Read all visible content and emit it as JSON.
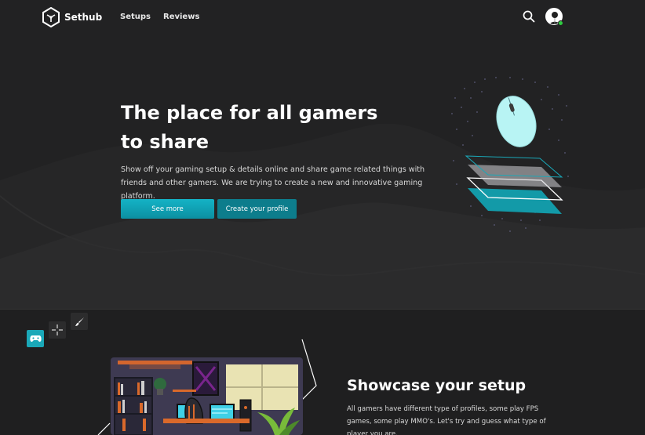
{
  "nav": {
    "brand": "Sethub",
    "links": [
      "Setups",
      "Reviews"
    ],
    "search_icon": "search-icon",
    "avatar_icon": "user-avatar"
  },
  "hero": {
    "title": "The place for all gamers\nto share",
    "description": "Show off your gaming setup & details online and share game related things with friends and other gamers. We are trying to create a new and innovative gaming platform.",
    "primary_button": "See more",
    "secondary_button": "Create your profile"
  },
  "tools": [
    "gamepad-icon",
    "crosshair-icon",
    "brush-icon"
  ],
  "showcase": {
    "title": "Showcase your setup",
    "description": "All gamers have different type of profiles, some play FPS games, some play MMO's. Let's try and guess what type of player you are."
  },
  "colors": {
    "accent": "#14b3c6",
    "accent_dark": "#0d7d8c",
    "background": "#1f1f20",
    "mouse": "#b8f4f4"
  }
}
